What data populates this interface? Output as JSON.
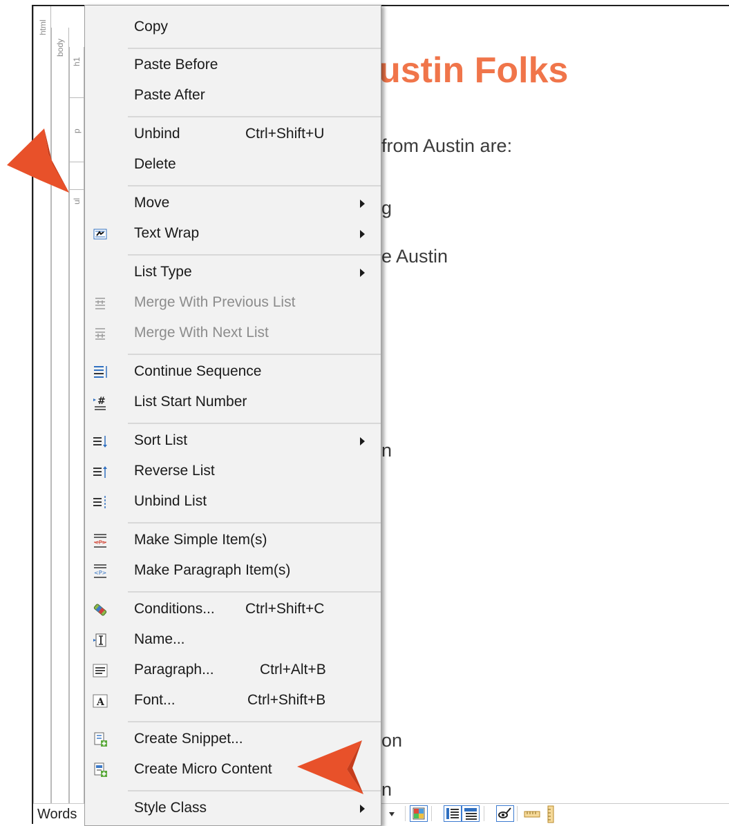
{
  "structure_bars": {
    "html_label": "html",
    "body_label": "body",
    "h1_label": "h1",
    "p_label": "p",
    "ul_label": "ul"
  },
  "document": {
    "heading_fragment": "ustin Folks",
    "line1_fragment": "from Austin are:",
    "line2_fragment": "g",
    "line3_fragment": "e Austin",
    "line4_fragment": "n",
    "line5_fragment": "on",
    "line6_fragment": "n"
  },
  "status_bar": {
    "words_label": "Words"
  },
  "context_menu": {
    "items": [
      {
        "label": "Copy",
        "shortcut": "",
        "submenu": false,
        "disabled": false,
        "icon": ""
      },
      {
        "label": "Paste Before",
        "shortcut": "",
        "submenu": false,
        "disabled": false,
        "icon": ""
      },
      {
        "label": "Paste After",
        "shortcut": "",
        "submenu": false,
        "disabled": false,
        "icon": ""
      },
      {
        "label": "Unbind",
        "shortcut": "Ctrl+Shift+U",
        "submenu": false,
        "disabled": false,
        "icon": ""
      },
      {
        "label": "Delete",
        "shortcut": "",
        "submenu": false,
        "disabled": false,
        "icon": ""
      },
      {
        "label": "Move",
        "shortcut": "",
        "submenu": true,
        "disabled": false,
        "icon": ""
      },
      {
        "label": "Text Wrap",
        "shortcut": "",
        "submenu": true,
        "disabled": false,
        "icon": "text-wrap-icon"
      },
      {
        "label": "List Type",
        "shortcut": "",
        "submenu": true,
        "disabled": false,
        "icon": ""
      },
      {
        "label": "Merge With Previous List",
        "shortcut": "",
        "submenu": false,
        "disabled": true,
        "icon": "merge-previous-icon"
      },
      {
        "label": "Merge With Next List",
        "shortcut": "",
        "submenu": false,
        "disabled": true,
        "icon": "merge-next-icon"
      },
      {
        "label": "Continue Sequence",
        "shortcut": "",
        "submenu": false,
        "disabled": false,
        "icon": "continue-sequence-icon"
      },
      {
        "label": "List Start Number",
        "shortcut": "",
        "submenu": false,
        "disabled": false,
        "icon": "list-start-number-icon"
      },
      {
        "label": "Sort List",
        "shortcut": "",
        "submenu": true,
        "disabled": false,
        "icon": "sort-list-icon"
      },
      {
        "label": "Reverse List",
        "shortcut": "",
        "submenu": false,
        "disabled": false,
        "icon": "reverse-list-icon"
      },
      {
        "label": "Unbind List",
        "shortcut": "",
        "submenu": false,
        "disabled": false,
        "icon": "unbind-list-icon"
      },
      {
        "label": "Make Simple Item(s)",
        "shortcut": "",
        "submenu": false,
        "disabled": false,
        "icon": "make-simple-item-icon"
      },
      {
        "label": "Make Paragraph Item(s)",
        "shortcut": "",
        "submenu": false,
        "disabled": false,
        "icon": "make-paragraph-item-icon"
      },
      {
        "label": "Conditions...",
        "shortcut": "Ctrl+Shift+C",
        "submenu": false,
        "disabled": false,
        "icon": "conditions-icon"
      },
      {
        "label": "Name...",
        "shortcut": "",
        "submenu": false,
        "disabled": false,
        "icon": "name-icon"
      },
      {
        "label": "Paragraph...",
        "shortcut": "Ctrl+Alt+B",
        "submenu": false,
        "disabled": false,
        "icon": "paragraph-icon"
      },
      {
        "label": "Font...",
        "shortcut": "Ctrl+Shift+B",
        "submenu": false,
        "disabled": false,
        "icon": "font-icon"
      },
      {
        "label": "Create Snippet...",
        "shortcut": "",
        "submenu": false,
        "disabled": false,
        "icon": "create-snippet-icon"
      },
      {
        "label": "Create Micro Content",
        "shortcut": "",
        "submenu": false,
        "disabled": false,
        "icon": "create-micro-content-icon"
      },
      {
        "label": "Style Class",
        "shortcut": "",
        "submenu": true,
        "disabled": false,
        "icon": ""
      }
    ]
  },
  "colors": {
    "heading": "#f0754a",
    "callout": "#e8512a",
    "menu_bg": "#f2f2f2",
    "disabled_text": "#8c8c8c",
    "toolbar_accent": "#3b7bd0"
  }
}
